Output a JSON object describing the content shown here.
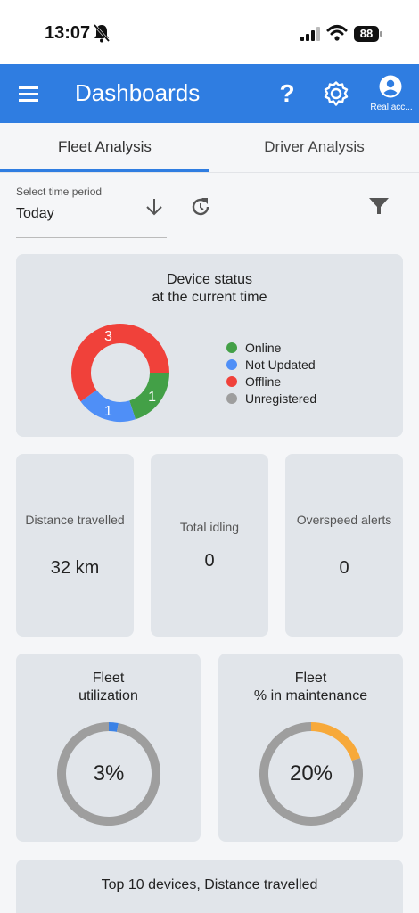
{
  "status_bar": {
    "time": "13:07",
    "battery": "88",
    "icons": [
      "bell-slash-icon",
      "signal-icon",
      "wifi-icon",
      "battery-icon"
    ]
  },
  "app_bar": {
    "title": "Dashboards",
    "help_label": "?",
    "account_label": "Real acc...",
    "color": "#2f7de1",
    "icons": [
      "menu-icon",
      "help-icon",
      "settings-icon",
      "account-icon"
    ]
  },
  "tabs": [
    {
      "label": "Fleet Analysis",
      "selected": true
    },
    {
      "label": "Driver Analysis",
      "selected": false
    }
  ],
  "time_period": {
    "label": "Select time period",
    "value": "Today"
  },
  "device_status": {
    "title_line1": "Device status",
    "title_line2": "at the current time",
    "chart_data": {
      "type": "pie",
      "donut": true,
      "categories": [
        "Online",
        "Not Updated",
        "Offline",
        "Unregistered"
      ],
      "values": [
        1,
        1,
        3,
        0
      ],
      "colors": [
        "#43a047",
        "#4f8ff7",
        "#f0413a",
        "#9e9e9e"
      ],
      "data_labels": [
        "1",
        "1",
        "3",
        ""
      ],
      "legend_position": "right"
    }
  },
  "stats": {
    "distance": {
      "label": "Distance travelled",
      "value": "32 km"
    },
    "idling": {
      "label": "Total idling",
      "value": "0"
    },
    "overspeed": {
      "label": "Overspeed alerts",
      "value": "0"
    }
  },
  "fleet_utilization": {
    "title_line1": "Fleet",
    "title_line2": "utilization",
    "value_text": "3%",
    "chart_data": {
      "type": "pie",
      "donut": true,
      "values": [
        3,
        97
      ],
      "colors": [
        "#3b82e6",
        "#9e9e9e"
      ]
    }
  },
  "fleet_maintenance": {
    "title_line1": "Fleet",
    "title_line2": "% in maintenance",
    "value_text": "20%",
    "chart_data": {
      "type": "pie",
      "donut": true,
      "values": [
        20,
        80
      ],
      "colors": [
        "#f7a93a",
        "#9e9e9e"
      ]
    }
  },
  "top10": {
    "title": "Top 10 devices, Distance travelled"
  }
}
